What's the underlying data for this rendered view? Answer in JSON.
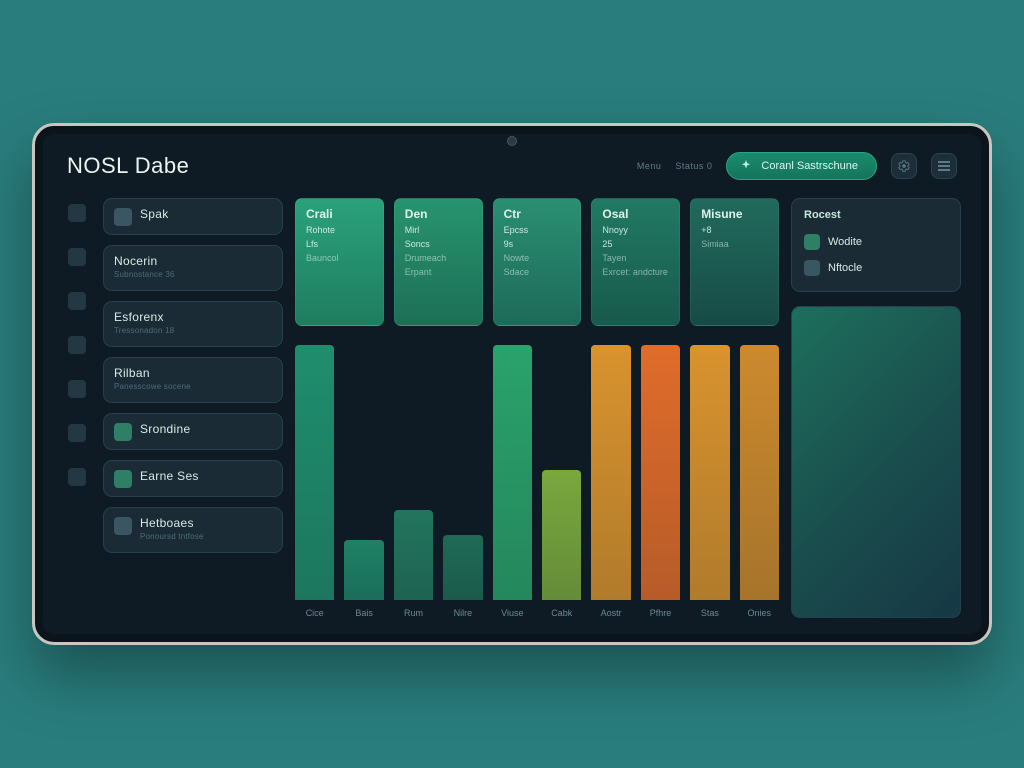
{
  "header": {
    "title": "NOSL Dabe",
    "menu_hint": "Menu",
    "status_small": "Status 0",
    "pill_label": "Coranl Sastrschune"
  },
  "rail_labels": [
    "",
    "",
    "",
    "",
    ""
  ],
  "sidebar": {
    "items": [
      {
        "title": "Spak",
        "sub": ""
      },
      {
        "title": "Nocerin",
        "sub": "Subnostance 36"
      },
      {
        "title": "Esforenx",
        "sub": "Tressonadon 18"
      },
      {
        "title": "Rilban",
        "sub": "Panesscowe socene"
      },
      {
        "title": "Srondine",
        "sub": ""
      },
      {
        "title": "Earne Ses",
        "sub": ""
      },
      {
        "title": "Hetboaes",
        "sub": "Ponoursd tntfose"
      }
    ]
  },
  "main": {
    "cards": [
      {
        "title": "Crali",
        "l2": "Rohote",
        "l3": "Lfs",
        "l4": "Bauncol",
        "l5": ""
      },
      {
        "title": "Den",
        "l2": "Mirl",
        "l3": "Soncs",
        "l4": "Drumeach",
        "l5": "Erpant"
      },
      {
        "title": "Ctr",
        "l2": "Epcss",
        "l3": "9s",
        "l4": "Nowte",
        "l5": "Sdace"
      },
      {
        "title": "Osal",
        "l2": "Nnoyy",
        "l3": "25",
        "l4": "Tayen",
        "l5": "Exrcet: andcture"
      },
      {
        "title": "Misune",
        "l2": "+8",
        "l3": "",
        "l4": "Simiaa",
        "l5": ""
      }
    ]
  },
  "right": {
    "panel_title": "Rocest",
    "items": [
      {
        "label": "Wodite"
      },
      {
        "label": "Nftocle"
      }
    ]
  },
  "chart_data": {
    "type": "bar",
    "categories": [
      "Cice",
      "Bais",
      "Rum",
      "Nilre",
      "Viuse",
      "Cabk",
      "Aostr",
      "Pfhre",
      "Stas",
      "Onies"
    ],
    "values": [
      255,
      60,
      90,
      65,
      255,
      130,
      255,
      255,
      255,
      255
    ],
    "colors": [
      "#1f8e6d",
      "#1f8166",
      "#22755d",
      "#1f6a56",
      "#2aa26b",
      "#7aa83e",
      "#d9932e",
      "#e06c2a",
      "#d9932e",
      "#cc8a2d"
    ],
    "ylim": [
      0,
      260
    ],
    "title": "",
    "xlabel": "",
    "ylabel": ""
  }
}
